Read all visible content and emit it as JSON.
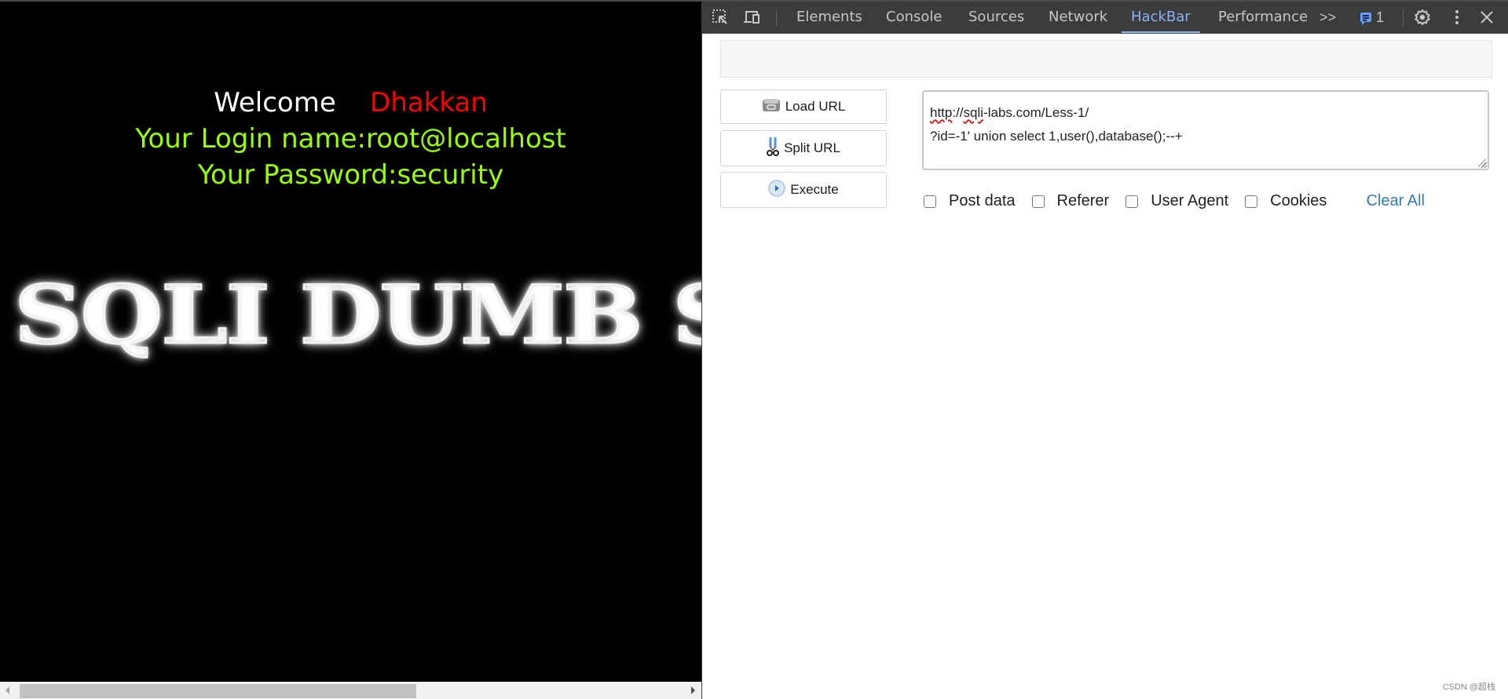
{
  "page": {
    "welcome_label": "Welcome",
    "welcome_name": "Dhakkan",
    "login_line": "Your Login name:root@localhost",
    "password_line": "Your Password:security",
    "banner_text": "SQLI DUMB SERIES",
    "colors": {
      "welcome": "#ffffff",
      "name": "#ff0000",
      "info": "#99ff00",
      "background": "#000000"
    }
  },
  "devtools": {
    "tabs": [
      {
        "label": "Elements",
        "active": false
      },
      {
        "label": "Console",
        "active": false
      },
      {
        "label": "Sources",
        "active": false
      },
      {
        "label": "Network",
        "active": false
      },
      {
        "label": "HackBar",
        "active": true
      },
      {
        "label": "Performance",
        "active": false
      }
    ],
    "more_tabs_label": ">>",
    "issues_count": "1",
    "icons": {
      "inspect": "inspect-element-icon",
      "device": "device-toolbar-icon",
      "issues": "message-icon",
      "settings": "gear-icon",
      "menu": "kebab-menu-icon",
      "close": "close-icon"
    },
    "accent_color": "#8ab4f8"
  },
  "hackbar": {
    "buttons": {
      "load_url": "Load URL",
      "split_url": "Split URL",
      "execute": "Execute"
    },
    "url_line1_prefix": "http",
    "url_line1_mid": "://",
    "url_line1_sq": "sqli",
    "url_line1_rest": "-labs.com/Less-1/",
    "url_line2": "?id=-1' union select 1,user(),database();--+",
    "checkboxes": [
      {
        "label": "Post data",
        "checked": false
      },
      {
        "label": "Referer",
        "checked": false
      },
      {
        "label": "User Agent",
        "checked": false
      },
      {
        "label": "Cookies",
        "checked": false
      }
    ],
    "clear_all": "Clear All",
    "link_color": "#337ab7"
  },
  "watermark": "CSDN @超栈"
}
